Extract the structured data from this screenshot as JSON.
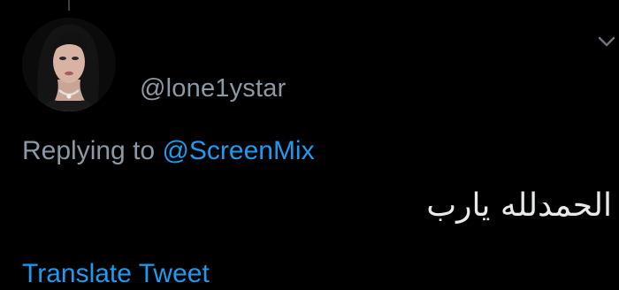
{
  "tweet": {
    "handle": "@lone1ystar",
    "replying_prefix": "Replying to",
    "replying_to": "@ScreenMix",
    "text": "الحمدلله يارب",
    "translate_label": "Translate Tweet"
  },
  "icons": {
    "more": "chevron-down-icon",
    "avatar": "profile-photo"
  },
  "colors": {
    "background": "#000000",
    "secondary_text": "#8b98a5",
    "link": "#1d9bf0",
    "primary_text": "#e7e9ea"
  }
}
